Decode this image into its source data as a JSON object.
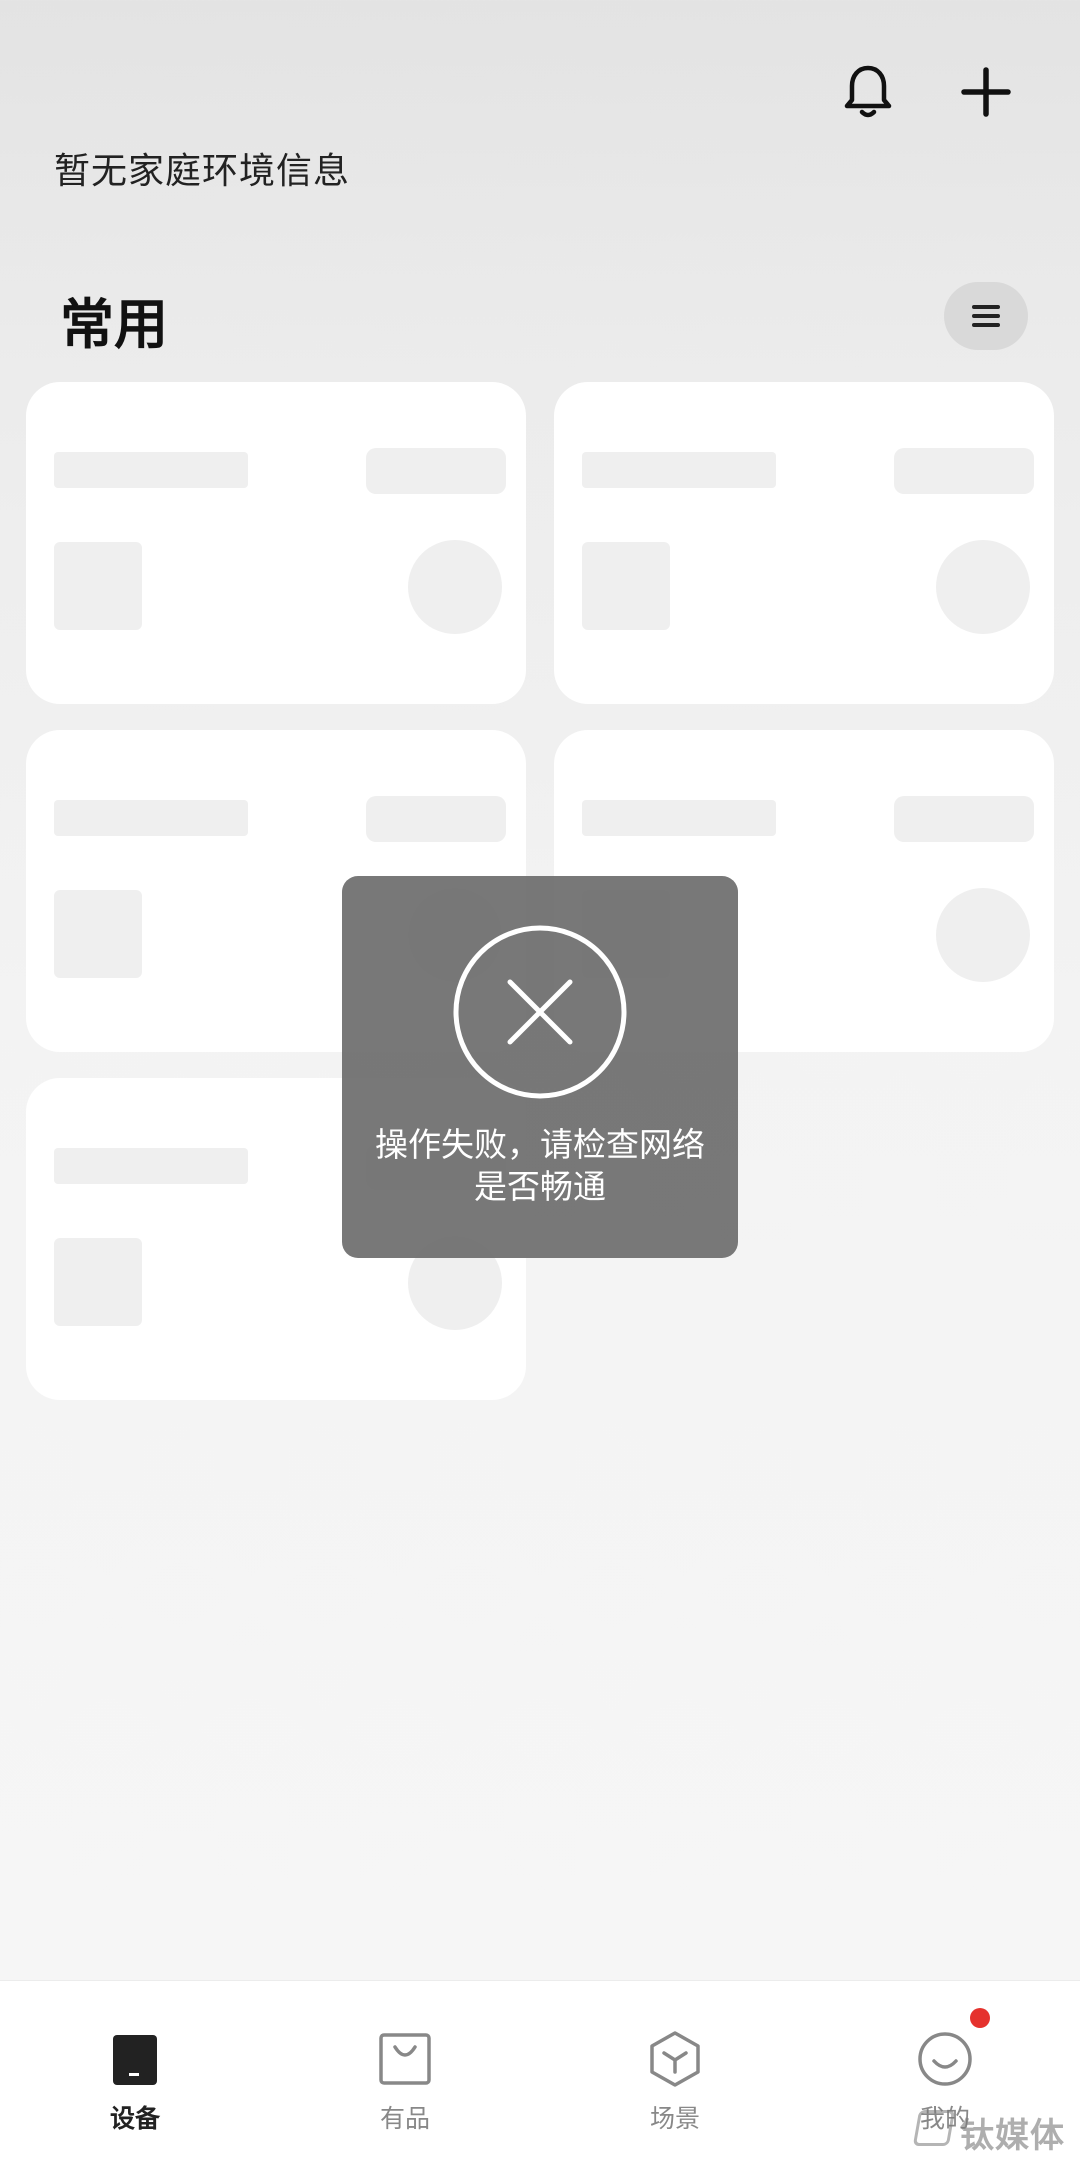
{
  "header": {
    "bell_icon": "bell-icon",
    "add_icon": "plus-icon",
    "home_info": "暂无家庭环境信息"
  },
  "section": {
    "title": "常用",
    "list_icon": "menu-icon"
  },
  "cards": [
    {
      "state": "loading"
    },
    {
      "state": "loading"
    },
    {
      "state": "loading"
    },
    {
      "state": "loading"
    },
    {
      "state": "loading"
    }
  ],
  "toast": {
    "icon": "close-circle-icon",
    "message": "操作失败，请检查网络是否畅通"
  },
  "tabbar": {
    "tabs": [
      {
        "label": "设备",
        "icon": "device-icon",
        "active": true
      },
      {
        "label": "有品",
        "icon": "shopping-bag-icon",
        "active": false
      },
      {
        "label": "场景",
        "icon": "cube-icon",
        "active": false
      },
      {
        "label": "我的",
        "icon": "smile-icon",
        "active": false,
        "badge": true
      }
    ]
  },
  "watermark": {
    "text": "钛媒体"
  },
  "colors": {
    "badge": "#e5322d",
    "toast_bg": "#6c6c6c",
    "active_tab": "#222222",
    "inactive_tab": "#888888"
  }
}
